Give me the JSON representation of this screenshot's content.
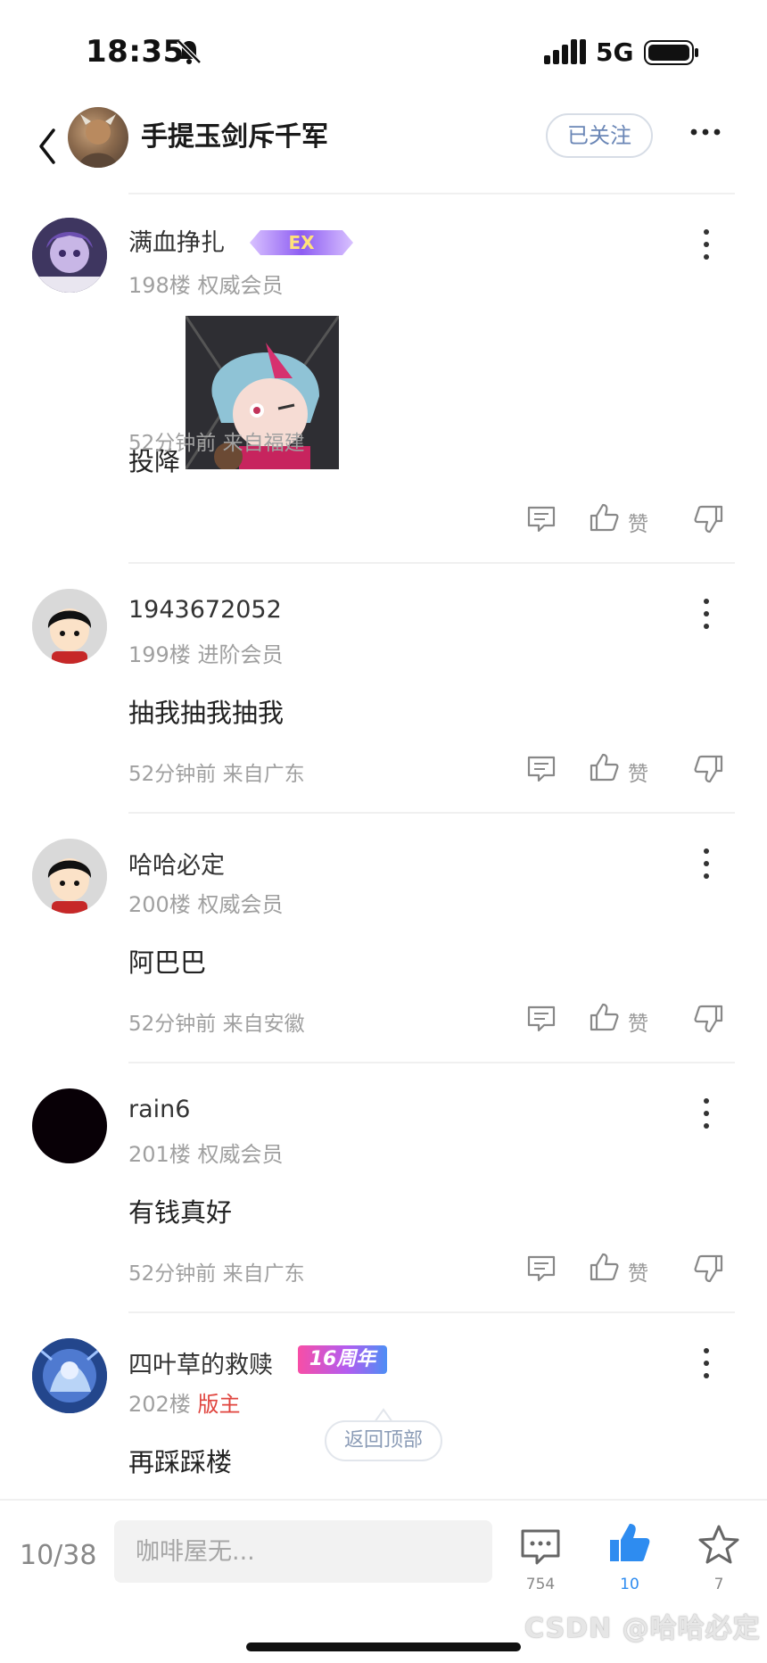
{
  "status_bar": {
    "time": "18:35",
    "network": "5G"
  },
  "header": {
    "title": "手提玉剑斥千军",
    "follow_label": "已关注"
  },
  "posts": [
    {
      "username": "满血挣扎",
      "floor": "198楼",
      "level": "权威会员",
      "body": "投降",
      "time": "52分钟前",
      "location": "来自福建",
      "like_label": "赞",
      "badge": "EX"
    },
    {
      "username": "1943672052",
      "floor": "199楼",
      "level": "进阶会员",
      "body": "抽我抽我抽我",
      "time": "52分钟前",
      "location": "来自广东",
      "like_label": "赞"
    },
    {
      "username": "哈哈必定",
      "floor": "200楼",
      "level": "权威会员",
      "body": "阿巴巴",
      "time": "52分钟前",
      "location": "来自安徽",
      "like_label": "赞"
    },
    {
      "username": "rain6",
      "floor": "201楼",
      "level": "权威会员",
      "body": "有钱真好",
      "time": "52分钟前",
      "location": "来自广东",
      "like_label": "赞"
    },
    {
      "username": "四叶草的救赎",
      "floor": "202楼",
      "level": "版主",
      "body": "再踩踩楼",
      "badge": "16周年"
    }
  ],
  "back_to_top": "返回顶部",
  "bottom_bar": {
    "page_indicator": "10/38",
    "input_placeholder": "咖啡屋无...",
    "comment_count": "754",
    "like_count": "10",
    "favorite_count": "7"
  },
  "watermark": "CSDN @哈哈必定",
  "colors": {
    "accent_blue": "#2e8cf0",
    "moderator_red": "#e0453f",
    "meta_gray": "#a0a0a0"
  },
  "icons": [
    "bell-muted-icon",
    "signal-icon",
    "battery-icon",
    "back-icon",
    "more-icon",
    "reply-icon",
    "like-icon",
    "dislike-icon",
    "comment-icon",
    "thumbs-up-icon",
    "star-icon"
  ]
}
